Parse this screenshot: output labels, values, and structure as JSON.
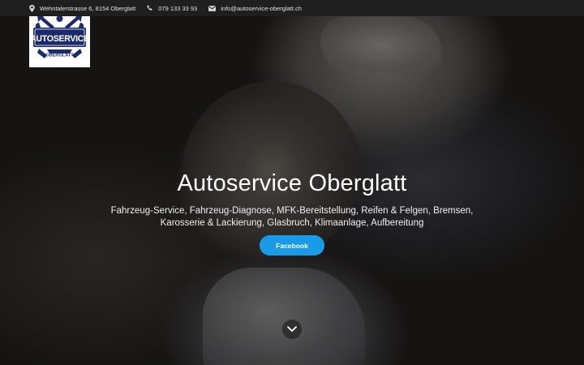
{
  "topbar": {
    "address": "Wehntalerstrasse 6, 8154 Oberglatt",
    "phone": "079 133 33 93",
    "email": "info@autoservice-oberglatt.ch",
    "icons": [
      "map-pin-icon",
      "phone-icon",
      "envelope-icon"
    ]
  },
  "logo": {
    "line1": "AUTOSERVICE",
    "line2": "OBERGLATT"
  },
  "hero": {
    "title": "Autoservice Oberglatt",
    "subtitle": "Fahrzeug-Service, Fahrzeug-Diagnose, MFK-Bereitstellung, Reifen & Felgen, Bremsen, Karosserie & Lackierung, Glasbruch, Klimaanlage, Aufbereitung",
    "button_label": "Facebook",
    "scroll_icon": "chevron-down-icon"
  },
  "colors": {
    "topbar_bg": "#1f1f1f",
    "button_bg": "#1a9be8",
    "logo_blue": "#1b2a6b"
  }
}
